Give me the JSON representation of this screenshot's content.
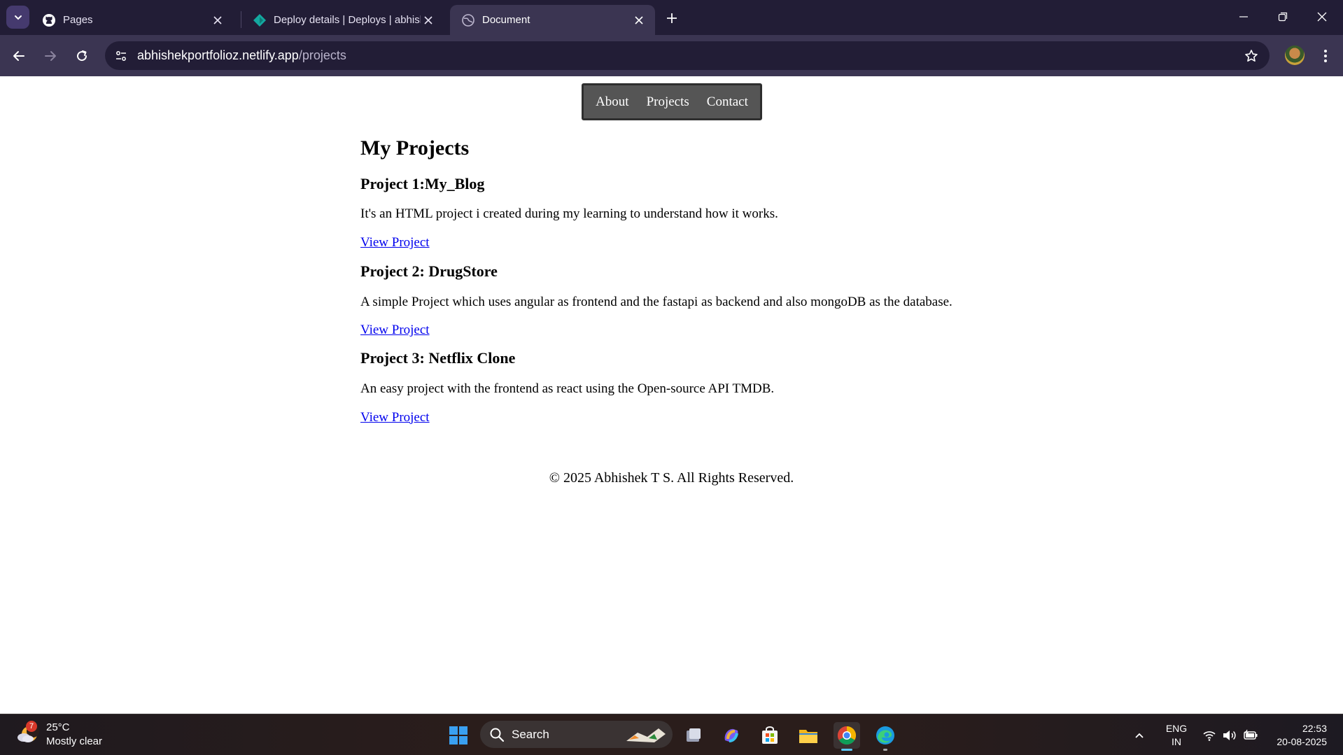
{
  "browser": {
    "tabs": [
      {
        "title": "Pages",
        "icon": "github-icon"
      },
      {
        "title": "Deploy details | Deploys | abhishekportfolioz",
        "icon": "netlify-icon"
      },
      {
        "title": "Document",
        "icon": "globe-icon",
        "active": true
      }
    ],
    "url_domain": "abhishekportfolioz.netlify.app",
    "url_path": "/projects"
  },
  "nav": {
    "items": [
      {
        "label": "About"
      },
      {
        "label": "Projects"
      },
      {
        "label": "Contact"
      }
    ]
  },
  "main": {
    "heading": "My Projects",
    "projects": [
      {
        "title": "Project 1:My_Blog",
        "description": "It's an HTML project i created during my learning to understand how it works.",
        "link_label": "View Project"
      },
      {
        "title": "Project 2: DrugStore",
        "description": "A simple Project which uses angular as frontend and the fastapi as backend and also mongoDB as the database.",
        "link_label": "View Project"
      },
      {
        "title": "Project 3: Netflix Clone",
        "description": "An easy project with the frontend as react using the Open-source API TMDB.",
        "link_label": "View Project"
      }
    ]
  },
  "footer": {
    "text": "© 2025 Abhishek T S. All Rights Reserved."
  },
  "taskbar": {
    "weather_temp": "25°C",
    "weather_desc": "Mostly clear",
    "weather_badge": "7",
    "search_label": "Search",
    "lang_line1": "ENG",
    "lang_line2": "IN",
    "time": "22:53",
    "date": "20-08-2025"
  },
  "colors": {
    "tabstrip": "#221d36",
    "toolbar": "#3b3552",
    "navbar": "#555555",
    "link": "#0000ee"
  }
}
